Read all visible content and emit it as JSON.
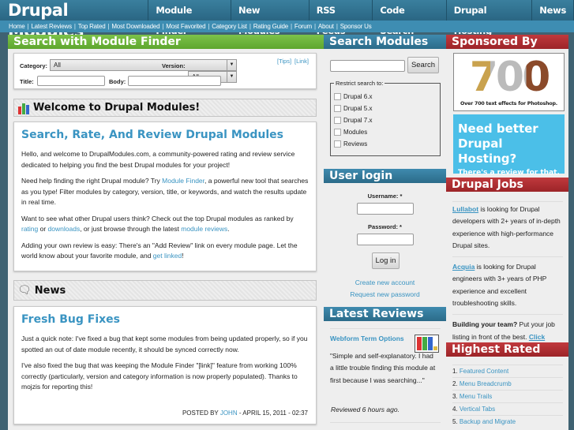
{
  "header": {
    "logo": "Drupal Modules",
    "nav": [
      "Module Finder",
      "New Modules",
      "RSS Feeds",
      "Code Search",
      "Drupal Hosting",
      "News"
    ]
  },
  "subnav": [
    "Home",
    "Latest Reviews",
    "Top Rated",
    "Most Downloaded",
    "Most Favorited",
    "Category List",
    "Rating Guide",
    "Forum",
    "About",
    "Sponsor Us"
  ],
  "finder": {
    "title": "Search with Module Finder",
    "category_label": "Category:",
    "category_value": "All",
    "version_label": "Version:",
    "version_value": "All",
    "tips": "[Tips]",
    "link": "[Link]",
    "title_label": "Title:",
    "body_label": "Body:"
  },
  "welcome": {
    "heading": "Welcome to Drupal Modules!",
    "title": "Search, Rate, And Review Drupal Modules",
    "p1": "Hello, and welcome to DrupalModules.com, a community-powered rating and review service dedicated to helping you find the best Drupal modules for your project!",
    "p2a": "Need help finding the right Drupal module? Try ",
    "p2link": "Module Finder",
    "p2b": ", a powerful new tool that searches as you type! Filter modules by category, version, title, or keywords, and watch the results update in real time.",
    "p3a": "Want to see what other Drupal users think? Check out the top Drupal modules as ranked by ",
    "p3l1": "rating",
    "p3b": " or ",
    "p3l2": "downloads",
    "p3c": ", or just browse through the latest ",
    "p3l3": "module reviews",
    "p3d": ".",
    "p4a": "Adding your own review is easy: There's an \"Add Review\" link on every module page. Let the world know about your favorite module, and ",
    "p4l": "get linked",
    "p4b": "!"
  },
  "news": {
    "heading": "News",
    "title": "Fresh Bug Fixes",
    "p1": "Just a quick note: I've fixed a bug that kept some modules from being updated properly, so if you spotted an out of date module recently, it should be synced correctly now.",
    "p2": "I've also fixed the bug that was keeping the Module Finder \"[link]\" feature from working 100% correctly (particularly, version and category information is now properly populated). Thanks to mojzis for reporting this!",
    "posted": "POSTED BY ",
    "author": "JOHN",
    "date": " - APRIL 15, 2011 - 02:37"
  },
  "search": {
    "title": "Search Modules",
    "button": "Search",
    "restrict": "Restrict search to:",
    "options": [
      "Drupal 6.x",
      "Drupal 5.x",
      "Drupal 7.x",
      "Modules",
      "Reviews"
    ]
  },
  "login": {
    "title": "User login",
    "username": "Username: *",
    "password": "Password: *",
    "button": "Log in",
    "create": "Create new account",
    "request": "Request new password"
  },
  "reviews": {
    "title": "Latest Reviews",
    "item_title": "Webform Term Options",
    "quote": "\"Simple and self-explanatory. I had a little trouble finding this module at first because I was searching...\"",
    "when": "Reviewed 6 hours ago."
  },
  "sponsor": {
    "title": "Sponsored By",
    "ad1_big": "700",
    "ad1_caption": "Over 700 text effects for Photoshop.",
    "ad2_line1": "Need better",
    "ad2_line2": "Drupal Hosting?",
    "ad2_line3": "There's a review for that."
  },
  "jobs": {
    "title": "Drupal Jobs",
    "j1link": "Lullabot",
    "j1": " is looking for Drupal developers with 2+ years of in-depth experience with high-performance Drupal sites.",
    "j2link": "Acquia",
    "j2": " is looking for Drupal engineers with 3+ years of PHP experience and excellent troubleshooting skills.",
    "j3bold": "Building your team?",
    "j3": " Put your job listing in front of the best. ",
    "j3link": "Click here!"
  },
  "highest": {
    "title": "Highest Rated",
    "items": [
      "Featured Content",
      "Menu Breadcrumb",
      "Menu Trails",
      "Vertical Tabs",
      "Backup and Migrate"
    ]
  }
}
